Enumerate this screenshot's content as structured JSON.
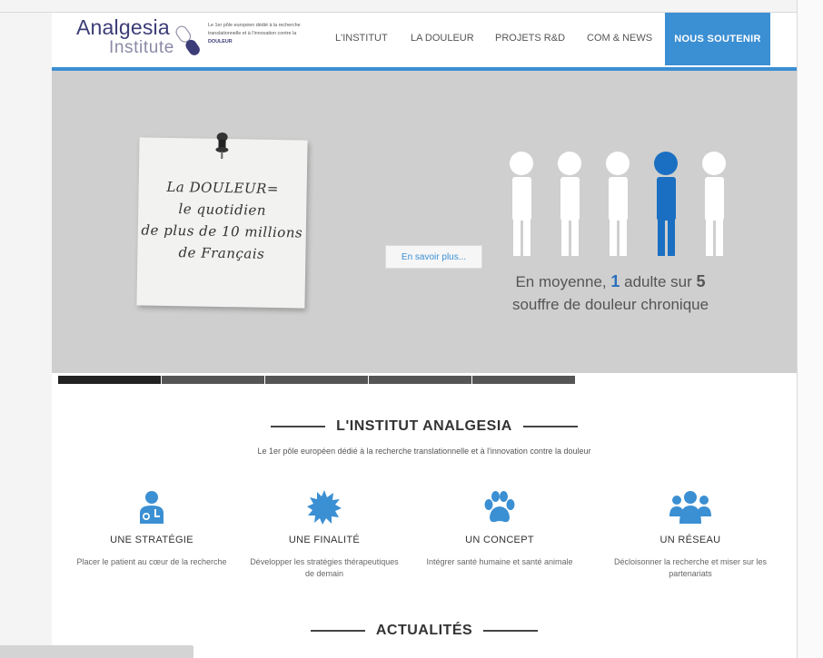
{
  "header": {
    "logo_word1": "Analgesia",
    "logo_word2": "Institute",
    "tagline_part1": "Le 1er pôle européen dédié à la recherche translationnelle et à l'innovation contre la",
    "tagline_part2": "DOULEUR"
  },
  "nav": {
    "items": [
      {
        "label": "L'INSTITUT"
      },
      {
        "label": "LA DOULEUR"
      },
      {
        "label": "PROJETS R&D"
      },
      {
        "label": "COM & NEWS"
      }
    ],
    "cta_label": "NOUS SOUTENIR"
  },
  "hero": {
    "note_lines": [
      "La DOULEUR=",
      "le quotidien",
      "de plus de 10 millions",
      "de Français"
    ],
    "button_label": "En savoir plus...",
    "stat_prefix": "En moyenne,",
    "stat_number": "1",
    "stat_mid": "adulte sur",
    "stat_total": "5",
    "stat_line2": "souffre de douleur chronique",
    "slides_count": 5,
    "active_slide": 1
  },
  "institut": {
    "title": "L'INSTITUT ANALGESIA",
    "subtitle": "Le 1er pôle européen dédié à la recherche translationnelle et à l'innovation contre la douleur",
    "features": [
      {
        "title": "UNE STRATÉGIE",
        "desc": "Placer le patient au cœur de la recherche",
        "icon": "doctor-icon"
      },
      {
        "title": "UNE FINALITÉ",
        "desc": "Développer les stratégies thérapeutiques de demain",
        "icon": "starburst-icon"
      },
      {
        "title": "UN CONCEPT",
        "desc": "Intégrer santé humaine et santé animale",
        "icon": "paw-icon"
      },
      {
        "title": "UN RÉSEAU",
        "desc": "Décloisonner la recherche et miser sur les partenariats",
        "icon": "group-icon"
      }
    ]
  },
  "actualites": {
    "title": "ACTUALITÉS"
  },
  "colors": {
    "accent": "#3b8fd3",
    "logo": "#3c3c78",
    "highlight_person": "#1a6fc2"
  }
}
